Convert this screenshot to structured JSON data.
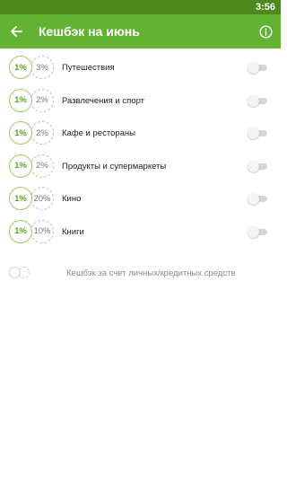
{
  "status_bar": {
    "time": "3:56"
  },
  "app_bar": {
    "title": "Кешбэк на июнь"
  },
  "categories": [
    {
      "percent_a": "1%",
      "percent_b": "3%",
      "label": "Путешествия",
      "enabled": false
    },
    {
      "percent_a": "1%",
      "percent_b": "2%",
      "label": "Развлечения и спорт",
      "enabled": false
    },
    {
      "percent_a": "1%",
      "percent_b": "2%",
      "label": "Кафе и рестораны",
      "enabled": false
    },
    {
      "percent_a": "1%",
      "percent_b": "2%",
      "label": "Продукты и супермаркеты",
      "enabled": false
    },
    {
      "percent_a": "1%",
      "percent_b": "20%",
      "label": "Кино",
      "enabled": false
    },
    {
      "percent_a": "1%",
      "percent_b": "10%",
      "label": "Книги",
      "enabled": false
    }
  ],
  "footer": {
    "text": "Кешбэк за счет личных/кредитных средств"
  },
  "colors": {
    "status_bar": "#4c8a1e",
    "app_bar": "#64b234",
    "accent_green": "#5aa12a"
  },
  "icons": {
    "back": "arrow-left-icon",
    "info": "info-icon"
  }
}
